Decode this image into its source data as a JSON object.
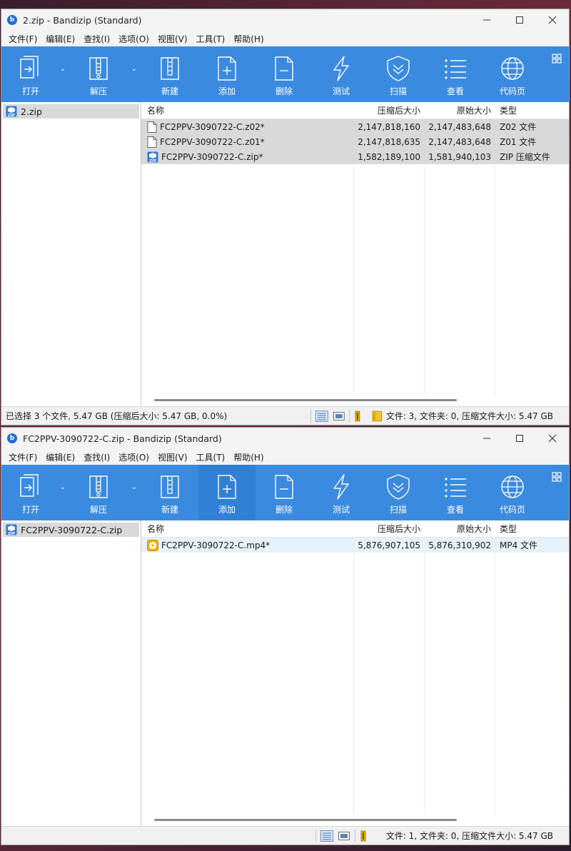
{
  "toolbar_buttons": {
    "open": "打开",
    "extract": "解压",
    "new": "新建",
    "add": "添加",
    "delete": "删除",
    "test": "测试",
    "scan": "扫描",
    "view": "查看",
    "codepage": "代码页"
  },
  "menu": [
    "文件(F)",
    "编辑(E)",
    "查找(I)",
    "选项(O)",
    "视图(V)",
    "工具(T)",
    "帮助(H)"
  ],
  "columns": {
    "name": "名称",
    "packed": "压缩后大小",
    "size": "原始大小",
    "type": "类型"
  },
  "window1": {
    "title": "2.zip - Bandizip (Standard)",
    "tree_item": "2.zip",
    "files": [
      {
        "name": "FC2PPV-3090722-C.z02*",
        "packed": "2,147,818,160",
        "size": "2,147,483,648",
        "type": "Z02 文件",
        "icon": "generic-file-icon"
      },
      {
        "name": "FC2PPV-3090722-C.z01*",
        "packed": "2,147,818,635",
        "size": "2,147,483,648",
        "type": "Z01 文件",
        "icon": "generic-file-icon"
      },
      {
        "name": "FC2PPV-3090722-C.zip*",
        "packed": "1,582,189,100",
        "size": "1,581,940,103",
        "type": "ZIP 压缩文件",
        "icon": "zip-file-icon"
      }
    ],
    "status_left": "已选择 3 个文件, 5.47 GB (压缩后大小: 5.47 GB, 0.0%)",
    "status_right": "文件: 3, 文件夹: 0, 压缩文件大小: 5.47 GB"
  },
  "window2": {
    "title": "FC2PPV-3090722-C.zip - Bandizip (Standard)",
    "tree_item": "FC2PPV-3090722-C.zip",
    "files": [
      {
        "name": "FC2PPV-3090722-C.mp4*",
        "packed": "5,876,907,105",
        "size": "5,876,310,902",
        "type": "MP4 文件",
        "icon": "video-file-icon"
      }
    ],
    "status_left": "",
    "status_right": "文件: 1, 文件夹: 0, 压缩文件大小: 5.47 GB"
  },
  "colors": {
    "toolbar": "#3a8ae0",
    "selection": "#d9d9d9",
    "highlight": "#e5f1fb",
    "brand": "#1e6fd0"
  }
}
